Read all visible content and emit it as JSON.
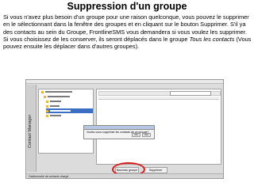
{
  "slide": {
    "title": "Suppression d'un groupe",
    "paragraph_main": "Si vous n'avez plus besoin d'un groupe pour une raison quelconque, vous pouvez le supprimer en le sélectionnant dans la fenêtre des groupes et en cliquant sur le bouton Supprimer. S'il ya des contacts au sein du Groupe, FrontlineSMS vous demandera si vous voulez les supprimer. Si vous choisissez de les conserver, ils seront déplacés dans le groupe ",
    "paragraph_italic": "Tous les contacts",
    "paragraph_end": " (Vous pouvez ensuite les déplacer dans d'autres groupes)."
  },
  "screenshot": {
    "side_tab": "Contact Manager",
    "dialog_message": "Voulez-vous supprimer les contacts de ce groupe?",
    "dialog_buttons": [
      "Oui",
      "Non"
    ],
    "bottom_buttons": [
      "Nouveau groupe",
      "Supprimer"
    ],
    "status_text": "Gestionnaire de contacts chargé"
  },
  "colors": {
    "highlight_circle": "#d81e1e",
    "selection": "#3a6fc4"
  }
}
